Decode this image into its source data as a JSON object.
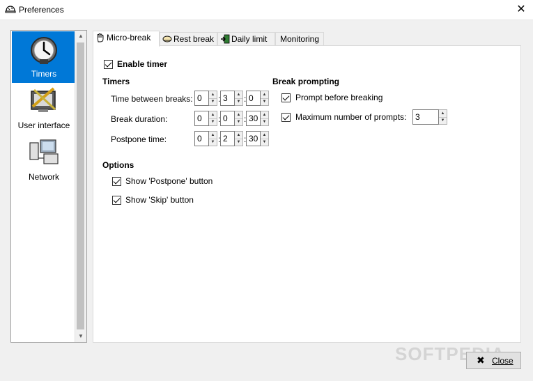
{
  "window": {
    "title": "Preferences",
    "close_glyph": "✕"
  },
  "sidebar": {
    "items": [
      {
        "label": "Timers",
        "icon": "clock-icon",
        "selected": true
      },
      {
        "label": "User interface",
        "icon": "monitor-tools-icon",
        "selected": false
      },
      {
        "label": "Network",
        "icon": "network-computers-icon",
        "selected": false
      }
    ]
  },
  "tabs": [
    {
      "label": "Micro-break",
      "icon": "hand-icon",
      "selected": true
    },
    {
      "label": "Rest break",
      "icon": "bed-icon",
      "selected": false
    },
    {
      "label": "Daily limit",
      "icon": "exit-door-icon",
      "selected": false
    },
    {
      "label": "Monitoring",
      "icon": "",
      "selected": false
    }
  ],
  "micro_break": {
    "enable_timer": {
      "label": "Enable timer",
      "checked": true
    },
    "timers": {
      "heading": "Timers",
      "rows": [
        {
          "label": "Time between breaks:",
          "h": "0",
          "m": "3",
          "s": "0"
        },
        {
          "label": "Break duration:",
          "h": "0",
          "m": "0",
          "s": "30"
        },
        {
          "label": "Postpone time:",
          "h": "0",
          "m": "2",
          "s": "30"
        }
      ]
    },
    "break_prompting": {
      "heading": "Break prompting",
      "prompt_before": {
        "label": "Prompt before breaking",
        "checked": true
      },
      "max_prompts": {
        "label": "Maximum number of prompts:",
        "checked": true,
        "value": "3"
      }
    },
    "options": {
      "heading": "Options",
      "show_postpone": {
        "label": "Show 'Postpone' button",
        "checked": true
      },
      "show_skip": {
        "label": "Show 'Skip' button",
        "checked": true
      }
    }
  },
  "footer": {
    "close_label": "Close"
  },
  "colors": {
    "selection": "#0078d7",
    "panel": "#ffffff",
    "window": "#f0f0f0"
  },
  "watermark": "SOFTPEDIA"
}
